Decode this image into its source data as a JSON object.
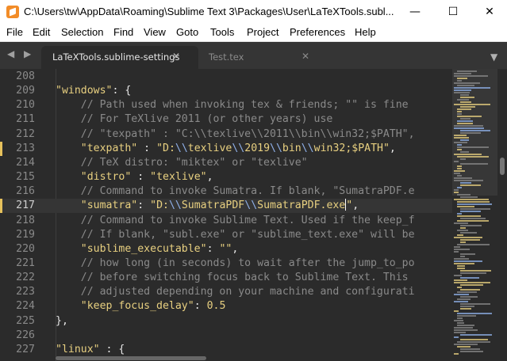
{
  "window": {
    "title": "C:\\Users\\tw\\AppData\\Roaming\\Sublime Text 3\\Packages\\User\\LaTeXTools.subl...",
    "minimize_glyph": "—",
    "maximize_glyph": "☐",
    "close_glyph": "✕"
  },
  "menu": [
    "File",
    "Edit",
    "Selection",
    "Find",
    "View",
    "Goto",
    "Tools",
    "Project",
    "Preferences",
    "Help"
  ],
  "tabs": {
    "nav_arrows": "◀ ▶",
    "active": {
      "label": "LaTeXTools.sublime-settings",
      "close": "✕"
    },
    "inactive": {
      "label": "Test.tex",
      "close": "✕"
    },
    "dropdown": "▼"
  },
  "editor": {
    "lines": [
      {
        "no": "208",
        "tokens": []
      },
      {
        "no": "209",
        "tokens": [
          {
            "t": "    ",
            "c": "punc"
          },
          {
            "t": "\"windows\"",
            "c": "key"
          },
          {
            "t": ": {",
            "c": "punc"
          }
        ]
      },
      {
        "no": "210",
        "tokens": [
          {
            "t": "        // Path used when invoking tex & friends; \"\" is fine",
            "c": "cmt"
          }
        ]
      },
      {
        "no": "211",
        "tokens": [
          {
            "t": "        // For TeXlive 2011 (or other years) use",
            "c": "cmt"
          }
        ]
      },
      {
        "no": "212",
        "tokens": [
          {
            "t": "        // \"texpath\" : \"C:\\\\texlive\\\\2011\\\\bin\\\\win32;$PATH\",",
            "c": "cmt"
          }
        ]
      },
      {
        "no": "213",
        "mark": true,
        "tokens": [
          {
            "t": "        ",
            "c": "punc"
          },
          {
            "t": "\"texpath\"",
            "c": "key"
          },
          {
            "t": " : ",
            "c": "punc"
          },
          {
            "t": "\"D:",
            "c": "str"
          },
          {
            "t": "\\\\",
            "c": "esc"
          },
          {
            "t": "texlive",
            "c": "str"
          },
          {
            "t": "\\\\",
            "c": "esc"
          },
          {
            "t": "2019",
            "c": "str"
          },
          {
            "t": "\\\\",
            "c": "esc"
          },
          {
            "t": "bin",
            "c": "str"
          },
          {
            "t": "\\\\",
            "c": "esc"
          },
          {
            "t": "win32;$PATH\"",
            "c": "str"
          },
          {
            "t": ",",
            "c": "punc"
          }
        ]
      },
      {
        "no": "214",
        "tokens": [
          {
            "t": "        // TeX distro: \"miktex\" or \"texlive\"",
            "c": "cmt"
          }
        ]
      },
      {
        "no": "215",
        "tokens": [
          {
            "t": "        ",
            "c": "punc"
          },
          {
            "t": "\"distro\"",
            "c": "key"
          },
          {
            "t": " : ",
            "c": "punc"
          },
          {
            "t": "\"texlive\"",
            "c": "str"
          },
          {
            "t": ",",
            "c": "punc"
          }
        ]
      },
      {
        "no": "216",
        "tokens": [
          {
            "t": "        // Command to invoke Sumatra. If blank, \"SumatraPDF.e",
            "c": "cmt"
          }
        ]
      },
      {
        "no": "217",
        "mark": true,
        "hl": true,
        "tokens": [
          {
            "t": "        ",
            "c": "punc"
          },
          {
            "t": "\"sumatra\"",
            "c": "key"
          },
          {
            "t": ": ",
            "c": "punc"
          },
          {
            "t": "\"D:",
            "c": "str"
          },
          {
            "t": "\\\\",
            "c": "esc"
          },
          {
            "t": "SumatraPDF",
            "c": "str"
          },
          {
            "t": "\\\\",
            "c": "esc"
          },
          {
            "t": "SumatraPDF.exe",
            "c": "str"
          },
          {
            "t": "|",
            "c": "caret"
          },
          {
            "t": "\"",
            "c": "str"
          },
          {
            "t": ",",
            "c": "punc"
          }
        ]
      },
      {
        "no": "218",
        "tokens": [
          {
            "t": "        // Command to invoke Sublime Text. Used if the keep_f",
            "c": "cmt"
          }
        ]
      },
      {
        "no": "219",
        "tokens": [
          {
            "t": "        // If blank, \"subl.exe\" or \"sublime_text.exe\" will be",
            "c": "cmt"
          }
        ]
      },
      {
        "no": "220",
        "tokens": [
          {
            "t": "        ",
            "c": "punc"
          },
          {
            "t": "\"sublime_executable\"",
            "c": "key"
          },
          {
            "t": ": ",
            "c": "punc"
          },
          {
            "t": "\"\"",
            "c": "str"
          },
          {
            "t": ",",
            "c": "punc"
          }
        ]
      },
      {
        "no": "221",
        "tokens": [
          {
            "t": "        // how long (in seconds) to wait after the jump_to_po",
            "c": "cmt"
          }
        ]
      },
      {
        "no": "222",
        "tokens": [
          {
            "t": "        // before switching focus back to Sublime Text. This",
            "c": "cmt"
          }
        ]
      },
      {
        "no": "223",
        "tokens": [
          {
            "t": "        // adjusted depending on your machine and configurati",
            "c": "cmt"
          }
        ]
      },
      {
        "no": "224",
        "tokens": [
          {
            "t": "        ",
            "c": "punc"
          },
          {
            "t": "\"keep_focus_delay\"",
            "c": "key"
          },
          {
            "t": ": ",
            "c": "punc"
          },
          {
            "t": "0.5",
            "c": "num"
          }
        ]
      },
      {
        "no": "225",
        "tokens": [
          {
            "t": "    },",
            "c": "punc"
          }
        ]
      },
      {
        "no": "226",
        "tokens": []
      },
      {
        "no": "227",
        "tokens": [
          {
            "t": "    ",
            "c": "punc"
          },
          {
            "t": "\"linux\"",
            "c": "key"
          },
          {
            "t": " : {",
            "c": "punc"
          }
        ]
      }
    ]
  },
  "colors": {
    "background": "#2b2b2b",
    "tabbar": "#353535",
    "string": "#e8d080",
    "comment": "#8a8a8a",
    "escape": "#8fb0e8",
    "modified_marker": "#e6c15c"
  }
}
